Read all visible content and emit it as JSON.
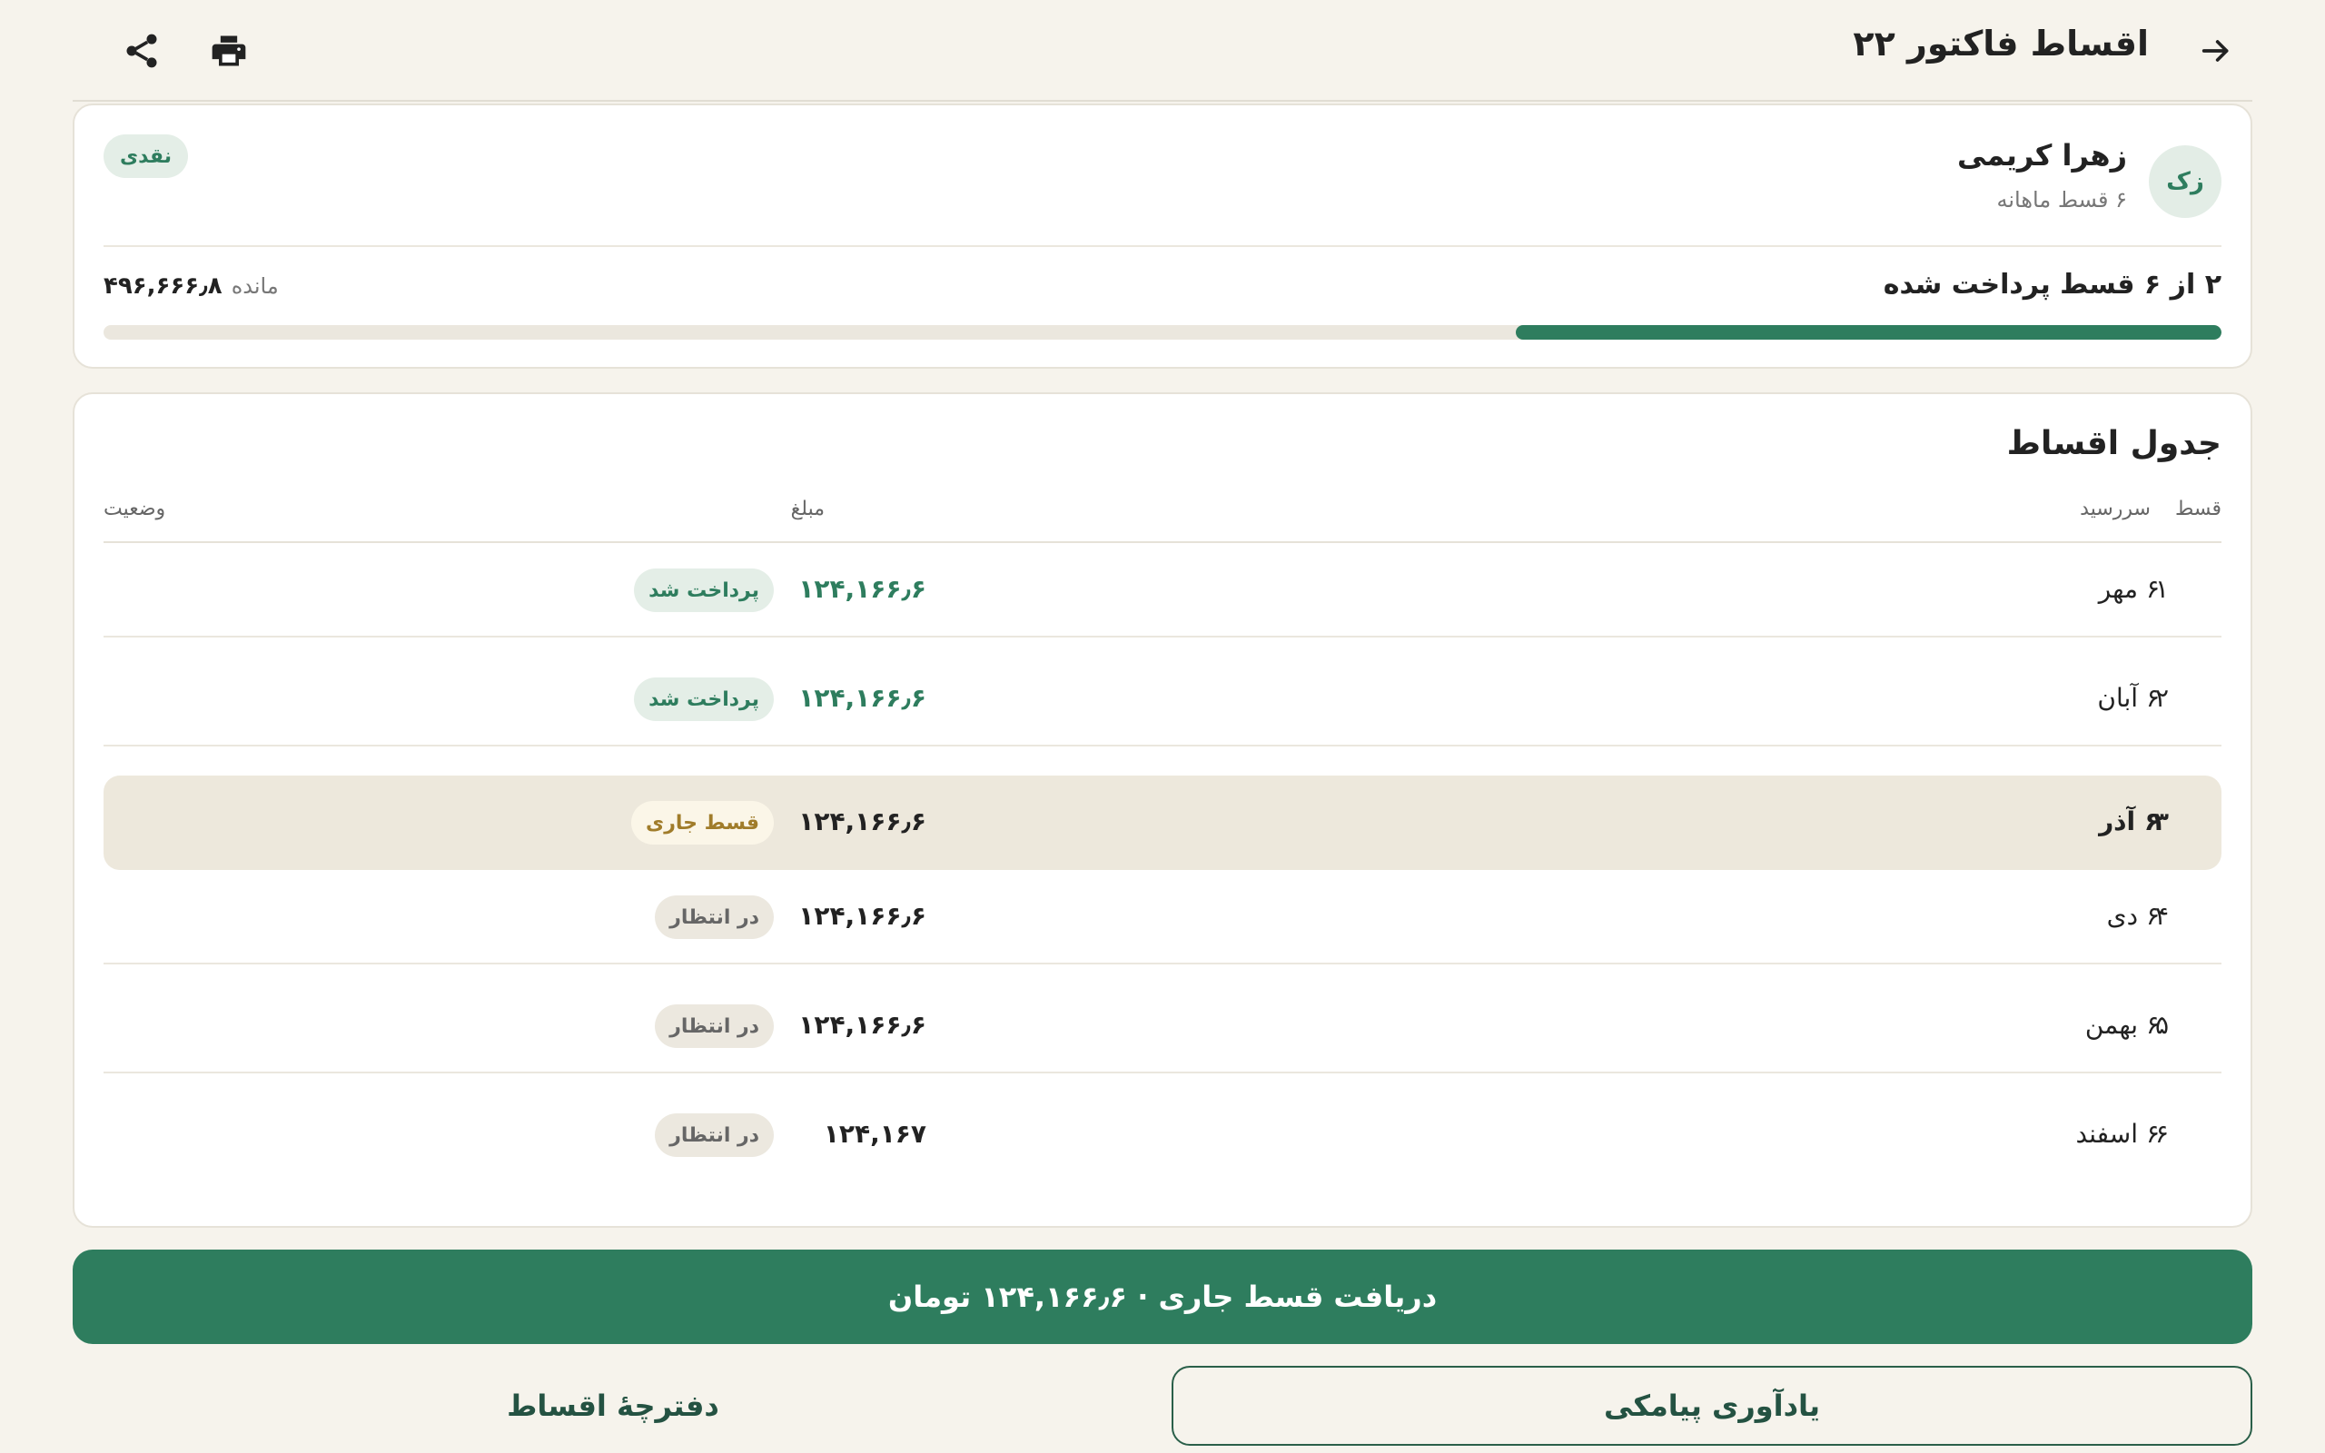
{
  "header": {
    "title": "اقساط فاکتور ۲۲",
    "back_icon": "arrow-right-icon",
    "share_icon": "share-icon",
    "print_icon": "print-icon"
  },
  "customer": {
    "initials": "زک",
    "name": "زهرا کریمی",
    "plan": "۶ قسط ماهانه",
    "payment_type": "نقدی"
  },
  "progress": {
    "paid_label": "۲ از ۶ قسط پرداخت شده",
    "remaining_label": "مانده",
    "remaining_value": "۴۹۶,۶۶۶٫۸",
    "paid": 2,
    "total": 6,
    "fraction": 0.3333
  },
  "schedule": {
    "title": "جدول اقساط",
    "columns": {
      "installment": "قسط",
      "due": "سررسید",
      "amount": "مبلغ",
      "status": "وضعیت"
    },
    "rows": [
      {
        "num": "۱",
        "due": "۶ مهر",
        "amount": "۱۲۴,۱۶۶٫۶",
        "status": "پرداخت شد",
        "state": "paid"
      },
      {
        "num": "۲",
        "due": "۶ آبان",
        "amount": "۱۲۴,۱۶۶٫۶",
        "status": "پرداخت شد",
        "state": "paid"
      },
      {
        "num": "۳",
        "due": "۶ آذر",
        "amount": "۱۲۴,۱۶۶٫۶",
        "status": "قسط جاری",
        "state": "current"
      },
      {
        "num": "۴",
        "due": "۶ دی",
        "amount": "۱۲۴,۱۶۶٫۶",
        "status": "در انتظار",
        "state": "pending"
      },
      {
        "num": "۵",
        "due": "۶ بهمن",
        "amount": "۱۲۴,۱۶۶٫۶",
        "status": "در انتظار",
        "state": "pending"
      },
      {
        "num": "۶",
        "due": "۶ اسفند",
        "amount": "۱۲۴,۱۶۷",
        "status": "در انتظار",
        "state": "pending"
      }
    ]
  },
  "actions": {
    "collect_label": "دریافت قسط جاری · ۱۲۴,۱۶۶٫۶ تومان",
    "sms_label": "یادآوری پیامکی",
    "booklet_label": "دفترچهٔ اقساط"
  },
  "colors": {
    "primary": "#2e7d5e",
    "background": "#f6f3ec",
    "current_row": "#ede8dc",
    "current_badge_text": "#a07c2a"
  }
}
